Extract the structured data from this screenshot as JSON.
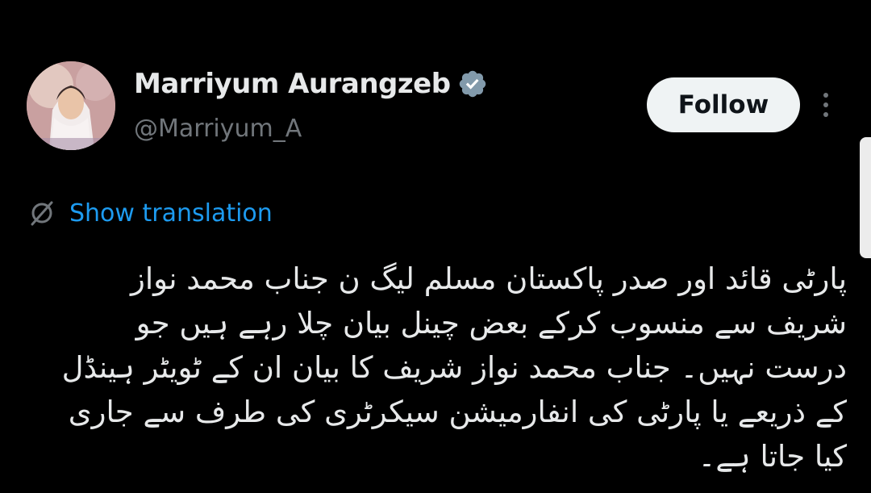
{
  "author": {
    "display_name": "Marriyum Aurangzeb",
    "handle": "@Marriyum_A",
    "verified": true
  },
  "actions": {
    "follow_label": "Follow"
  },
  "translation": {
    "label": "Show translation"
  },
  "tweet": {
    "lines": [
      "پارٹی قائد اور صدر پاکستان مسلم لیگ ن جناب محمد نواز",
      "شریف سے منسوب کرکے بعض چینل بیان چلا رہے ہیں جو",
      "درست نہیں۔ جناب محمد نواز شریف کا بیان ان کے ٹویٹر ہینڈل",
      "کے ذریعے یا پارٹی کی انفارمیشن سیکرٹری کی طرف سے جاری",
      "کیا جاتا ہے۔"
    ]
  },
  "colors": {
    "background": "#000000",
    "primary_text": "#e7e9ea",
    "secondary_text": "#71767b",
    "link": "#1d9bf0",
    "follow_bg": "#eff3f4",
    "follow_text": "#0f1419",
    "verified_badge": "#829aab"
  },
  "icons": {
    "verified": "verified-badge-icon",
    "more": "more-vertical-icon",
    "translate": "globe-icon"
  }
}
